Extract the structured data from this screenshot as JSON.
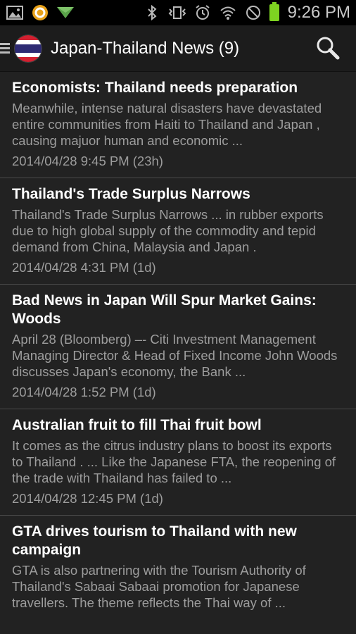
{
  "status": {
    "time": "9:26 PM",
    "left_icons": [
      "gallery-icon",
      "app-icon",
      "email-icon"
    ],
    "right_icons": [
      "bluetooth-icon",
      "vibrate-icon",
      "alarm-icon",
      "wifi-icon",
      "no-entry-icon",
      "battery-icon"
    ]
  },
  "header": {
    "title": "Japan-Thailand News (9)",
    "menu_icon": "hamburger-icon",
    "flag_icon": "thailand-flag-icon",
    "search_icon": "search-icon"
  },
  "articles": [
    {
      "title": "Economists: Thailand needs preparation",
      "desc": "Meanwhile, intense natural disasters have devastated entire communities from Haiti to Thailand and Japan , causing majuor human and economic ...",
      "date": "2014/04/28 9:45 PM (23h)"
    },
    {
      "title": "Thailand's Trade Surplus Narrows",
      "desc": "Thailand's Trade Surplus Narrows ... in rubber exports due to high global supply of the commodity and tepid demand from China, Malaysia and Japan .",
      "date": "2014/04/28 4:31 PM (1d)"
    },
    {
      "title": "Bad News in Japan Will Spur Market Gains: Woods",
      "desc": "April 28 (Bloomberg) –- Citi Investment Management Managing Director & Head of Fixed Income John Woods discusses Japan's economy, the Bank ...",
      "date": "2014/04/28 1:52 PM (1d)"
    },
    {
      "title": "Australian fruit to fill Thai fruit bowl",
      "desc": "It comes as the citrus industry plans to boost its exports to Thailand . ... Like the Japanese FTA, the reopening of the trade with Thailand has failed to ...",
      "date": "2014/04/28 12:45 PM (1d)"
    },
    {
      "title": "GTA drives tourism to Thailand with new campaign",
      "desc": "GTA is also partnering with the Tourism Authority of Thailand's Sabaai Sabaai promotion for Japanese travellers. The theme reflects the Thai way of ...",
      "date": ""
    }
  ]
}
